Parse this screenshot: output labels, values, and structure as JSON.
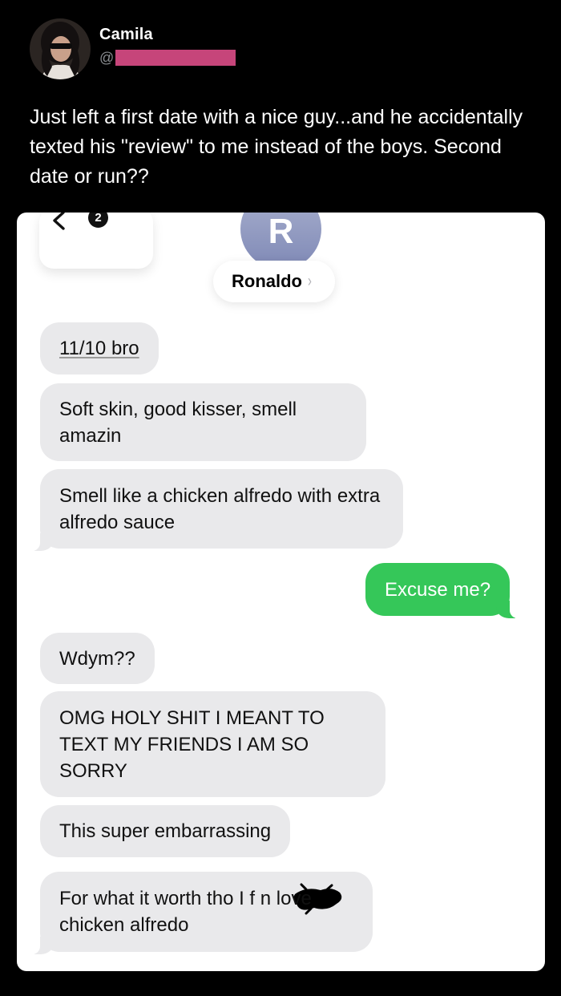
{
  "tweet": {
    "display_name": "Camila",
    "handle_prefix": "@",
    "text": "Just left a first date with a nice guy...and he accidentally texted his \"review\" to me instead of the boys. Second date or run??"
  },
  "conversation": {
    "back_badge_count": "2",
    "contact_initial": "R",
    "contact_name": "Ronaldo",
    "contact_chevron": "›",
    "messages": [
      {
        "direction": "incoming",
        "text": "11/10 bro"
      },
      {
        "direction": "incoming",
        "text": "Soft skin, good kisser, smell amazin"
      },
      {
        "direction": "incoming",
        "text": "Smell like a chicken alfredo with extra alfredo sauce"
      },
      {
        "direction": "outgoing",
        "text": "Excuse me?"
      },
      {
        "direction": "incoming",
        "text": "Wdym??"
      },
      {
        "direction": "incoming",
        "text": "OMG HOLY SHIT I MEANT TO TEXT MY FRIENDS I AM SO SORRY"
      },
      {
        "direction": "incoming",
        "text": "This super embarrassing"
      },
      {
        "direction": "incoming",
        "text": "For what it worth tho I f        n love chicken alfredo"
      }
    ]
  },
  "colors": {
    "background": "#000000",
    "card": "#ffffff",
    "incoming_bubble": "#e9e9eb",
    "outgoing_bubble": "#35c759",
    "handle_redaction": "#c6457a",
    "contact_avatar": "#8f98c0"
  },
  "icons": {
    "back": "chevron-left-icon",
    "contact_detail": "chevron-right-icon"
  }
}
